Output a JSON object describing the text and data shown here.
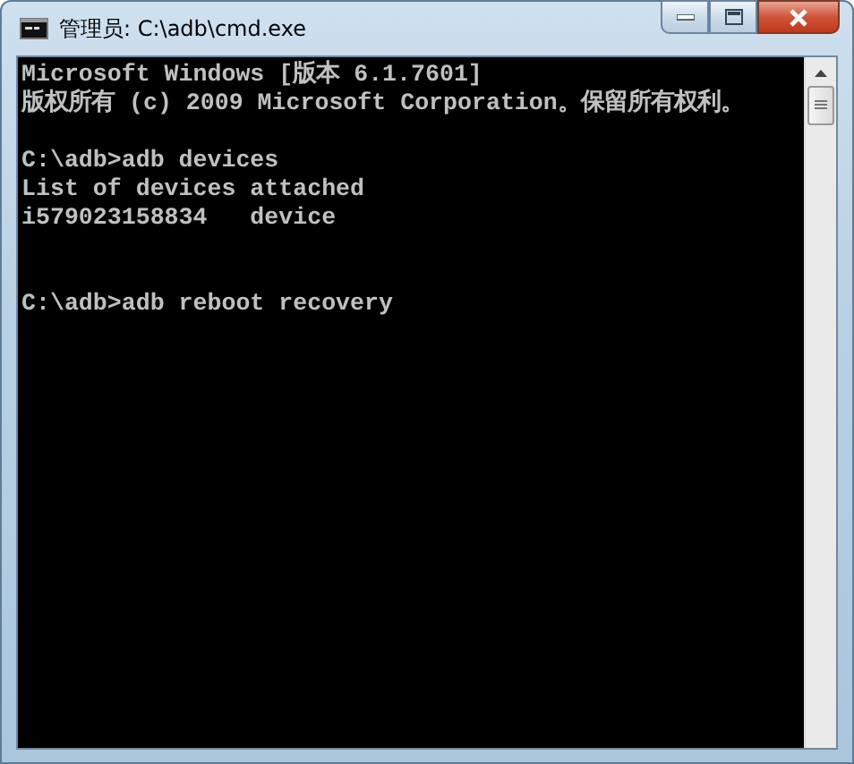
{
  "window": {
    "title": "管理员: C:\\adb\\cmd.exe"
  },
  "console": {
    "lines": [
      {
        "kind": "output",
        "text": "Microsoft Windows [版本 6.1.7601]"
      },
      {
        "kind": "output",
        "text": "版权所有 (c) 2009 Microsoft Corporation。保留所有权利。"
      },
      {
        "kind": "blank"
      },
      {
        "kind": "output",
        "text": "C:\\adb>adb devices"
      },
      {
        "kind": "output",
        "text": "List of devices attached"
      },
      {
        "kind": "output",
        "text": "i579023158834   device"
      },
      {
        "kind": "blank"
      },
      {
        "kind": "blank"
      },
      {
        "kind": "output",
        "text": "C:\\adb>adb reboot recovery"
      }
    ]
  }
}
